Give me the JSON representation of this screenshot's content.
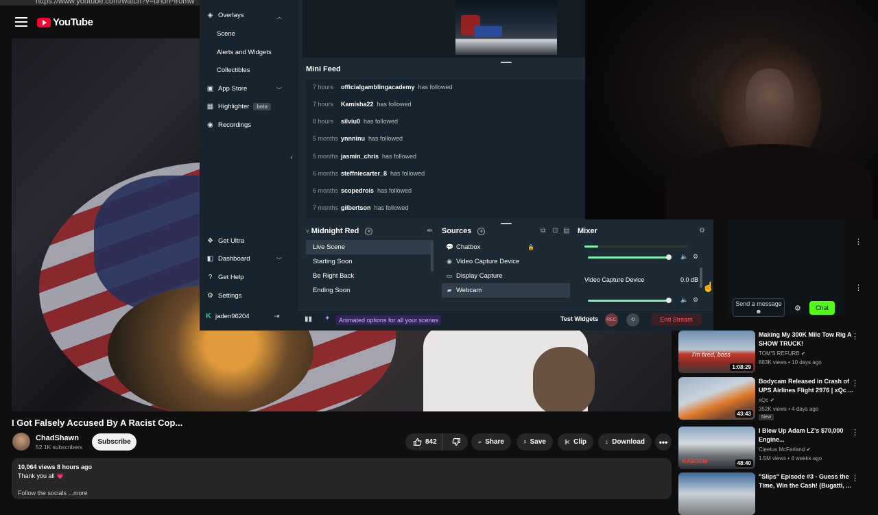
{
  "browser": {
    "url": "https://www.youtube.com/watch?v=undrPfromw"
  },
  "youtube": {
    "logo": "YouTube",
    "video": {
      "title": "I Got Falsely Accused By A Racist Cop...",
      "channel": "ChadShawn",
      "subs": "52.1K subscribers",
      "subscribe_label": "Subscribe",
      "likes": "842",
      "share_label": "Share",
      "save_label": "Save",
      "clip_label": "Clip",
      "download_label": "Download",
      "stats": "10,064 views  8 hours ago",
      "description": "Thank you all 💗",
      "desc_more": "Follow the socials ...more"
    },
    "recommendations": [
      {
        "title": "Making My 300K Mile Tow Rig A SHOW TRUCK!",
        "channel": "TOM'S REFURB ✔",
        "meta": "883K views • 10 days ago",
        "duration": "1:08:29",
        "thumb_text": "I'm tired, boss"
      },
      {
        "title": "Bodycam Released in Crash of UPS Airlines Flight 2976 | xQc ...",
        "channel": "xQc ✔",
        "meta": "352K views • 4 days ago",
        "badge": "New",
        "duration": "43:43"
      },
      {
        "title": "I Blew Up Adam LZ's $70,000 Engine...",
        "channel": "Cleetus McFarland ✔",
        "meta": "1.5M views • 4 weeks ago",
        "duration": "48:40",
        "thumb_text": "KABOOM"
      },
      {
        "title": "\"Slips\" Episode #3 - Guess the Time, Win the Cash! (Bugatti, ...",
        "channel": "",
        "meta": "",
        "duration": ""
      }
    ]
  },
  "streamlabs": {
    "nav": {
      "overlays": "Overlays",
      "scene": "Scene",
      "alerts": "Alerts and Widgets",
      "collectibles": "Collectibles",
      "app_store": "App Store",
      "highlighter": "Highlighter",
      "beta": "beta",
      "recordings": "Recordings",
      "get_ultra": "Get Ultra",
      "dashboard": "Dashboard",
      "get_help": "Get Help",
      "settings": "Settings",
      "user": "jaden96204"
    },
    "mini_feed": {
      "title": "Mini Feed",
      "items": [
        {
          "time": "7 hours",
          "name": "officialgamblingacademy",
          "action": "has followed"
        },
        {
          "time": "7 hours",
          "name": "Kamisha22",
          "action": "has followed"
        },
        {
          "time": "8 hours",
          "name": "silviu0",
          "action": "has followed"
        },
        {
          "time": "5 months",
          "name": "ynnninu",
          "action": "has followed"
        },
        {
          "time": "5 months",
          "name": "jasmin_chris",
          "action": "has followed"
        },
        {
          "time": "6 months",
          "name": "steffniecarter_8",
          "action": "has followed"
        },
        {
          "time": "6 months",
          "name": "scopedrois",
          "action": "has followed"
        },
        {
          "time": "7 months",
          "name": "gilbertson",
          "action": "has followed"
        }
      ]
    },
    "scenes": {
      "title": "Midnight Red",
      "items": [
        "Live Scene",
        "Starting Soon",
        "Be Right Back",
        "Ending Soon"
      ]
    },
    "sources": {
      "title": "Sources",
      "items": [
        "Chatbox",
        "Video Capture Device",
        "Display Capture",
        "Webcam"
      ]
    },
    "mixer": {
      "title": "Mixer",
      "source_name": "Video Capture Device",
      "source_db": "0.0 dB"
    },
    "bottom": {
      "animated_text": "Animated options for all your scenes",
      "test_widgets": "Test Widgets",
      "rec_label": "REC",
      "end_stream": "End Stream"
    }
  },
  "chat": {
    "placeholder": "Send a message",
    "button": "Chat"
  },
  "colors": {
    "youtube_red": "#ff0033",
    "kick_green": "#53fc18",
    "end_stream_red": "#ff5563"
  }
}
